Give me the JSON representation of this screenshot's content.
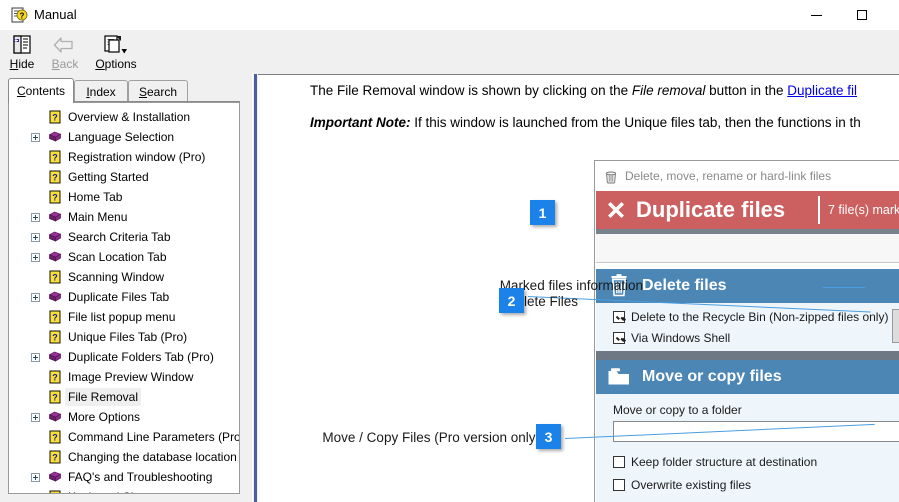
{
  "window": {
    "title": "Manual",
    "icon": "help-document-icon",
    "minimize_label": "Minimize",
    "maximize_label": "Maximize"
  },
  "toolbar": {
    "items": [
      {
        "label": "Hide",
        "accel": "H",
        "icon": "hide-pane-icon",
        "disabled": false
      },
      {
        "label": "Back",
        "accel": "B",
        "icon": "back-arrow-icon",
        "disabled": true
      },
      {
        "label": "Options",
        "accel": "O",
        "icon": "options-icon",
        "disabled": false
      }
    ]
  },
  "nav": {
    "tabs": [
      {
        "label": "Contents",
        "accel": "C",
        "active": true
      },
      {
        "label": "Index",
        "accel": "I",
        "active": false
      },
      {
        "label": "Search",
        "accel": "S",
        "active": false
      }
    ],
    "tree": [
      {
        "label": "Overview & Installation",
        "icon": "topic-icon",
        "expandable": false,
        "selected": false,
        "indent": 1
      },
      {
        "label": "Language Selection",
        "icon": "book-icon",
        "expandable": true,
        "selected": false,
        "indent": 1
      },
      {
        "label": "Registration window (Pro)",
        "icon": "topic-icon",
        "expandable": false,
        "selected": false,
        "indent": 1
      },
      {
        "label": "Getting Started",
        "icon": "topic-icon",
        "expandable": false,
        "selected": false,
        "indent": 1
      },
      {
        "label": "Home Tab",
        "icon": "topic-icon",
        "expandable": false,
        "selected": false,
        "indent": 1
      },
      {
        "label": "Main Menu",
        "icon": "book-icon",
        "expandable": true,
        "selected": false,
        "indent": 1
      },
      {
        "label": "Search Criteria Tab",
        "icon": "book-icon",
        "expandable": true,
        "selected": false,
        "indent": 1
      },
      {
        "label": "Scan Location Tab",
        "icon": "book-icon",
        "expandable": true,
        "selected": false,
        "indent": 1
      },
      {
        "label": "Scanning Window",
        "icon": "topic-icon",
        "expandable": false,
        "selected": false,
        "indent": 1
      },
      {
        "label": "Duplicate Files Tab",
        "icon": "book-icon",
        "expandable": true,
        "selected": false,
        "indent": 1
      },
      {
        "label": "File list popup menu",
        "icon": "topic-icon",
        "expandable": false,
        "selected": false,
        "indent": 1
      },
      {
        "label": "Unique Files Tab (Pro)",
        "icon": "topic-icon",
        "expandable": false,
        "selected": false,
        "indent": 1
      },
      {
        "label": "Duplicate Folders Tab (Pro)",
        "icon": "book-icon",
        "expandable": true,
        "selected": false,
        "indent": 1
      },
      {
        "label": "Image Preview Window",
        "icon": "topic-icon",
        "expandable": false,
        "selected": false,
        "indent": 1
      },
      {
        "label": "File Removal",
        "icon": "topic-icon",
        "expandable": false,
        "selected": true,
        "indent": 1
      },
      {
        "label": "More Options",
        "icon": "book-icon",
        "expandable": true,
        "selected": false,
        "indent": 1
      },
      {
        "label": "Command Line Parameters (Pro)",
        "icon": "topic-icon",
        "expandable": false,
        "selected": false,
        "indent": 1
      },
      {
        "label": "Changing the database location",
        "icon": "topic-icon",
        "expandable": false,
        "selected": false,
        "indent": 1
      },
      {
        "label": "FAQ's and Troubleshooting",
        "icon": "book-icon",
        "expandable": true,
        "selected": false,
        "indent": 1
      },
      {
        "label": "Keyboard Shortcuts",
        "icon": "topic-icon",
        "expandable": false,
        "selected": false,
        "indent": 1
      }
    ]
  },
  "document": {
    "paragraph1": {
      "part1": "The File Removal window is shown by clicking on the ",
      "emphasis": "File removal",
      "part2": " button in the ",
      "link": "Duplicate fil"
    },
    "paragraph2": {
      "lead": "Important Note:",
      "text": " If this window is launched from the Unique files tab, then the functions in th"
    }
  },
  "callouts": [
    {
      "number": "1",
      "label": "Marked files information"
    },
    {
      "number": "2",
      "label": "Delete Files"
    },
    {
      "number": "3",
      "label": "Move / Copy Files (Pro version only)"
    }
  ],
  "dialog": {
    "titlebar": {
      "icon": "recycle-bin-icon",
      "text": "Delete, move, rename or hard-link files"
    },
    "duplicate_header": {
      "icon": "x-mark-icon",
      "title": "Duplicate files",
      "count": "7 file(s) mark"
    },
    "delete_section": {
      "icon": "trash-can-icon",
      "title": "Delete files",
      "options": [
        {
          "label": "Delete to the Recycle Bin (Non-zipped files only)",
          "checked": true
        },
        {
          "label": "Via Windows Shell",
          "checked": true
        }
      ]
    },
    "move_section": {
      "icon": "folder-icon",
      "title": "Move or copy files",
      "field_label": "Move or copy to a folder",
      "field_value": "",
      "options": [
        {
          "label": "Keep folder structure at destination",
          "checked": false
        },
        {
          "label": "Overwrite existing files",
          "checked": false
        }
      ]
    }
  },
  "colors": {
    "badge_blue": "#1a82e8",
    "leader_blue": "#4a9de0",
    "header_red": "#cc5f5f",
    "section_blue": "#4b86b4",
    "panel_bg": "#eef5fb",
    "splitter_blue": "#4a5f9e",
    "link": "#0000ee"
  }
}
